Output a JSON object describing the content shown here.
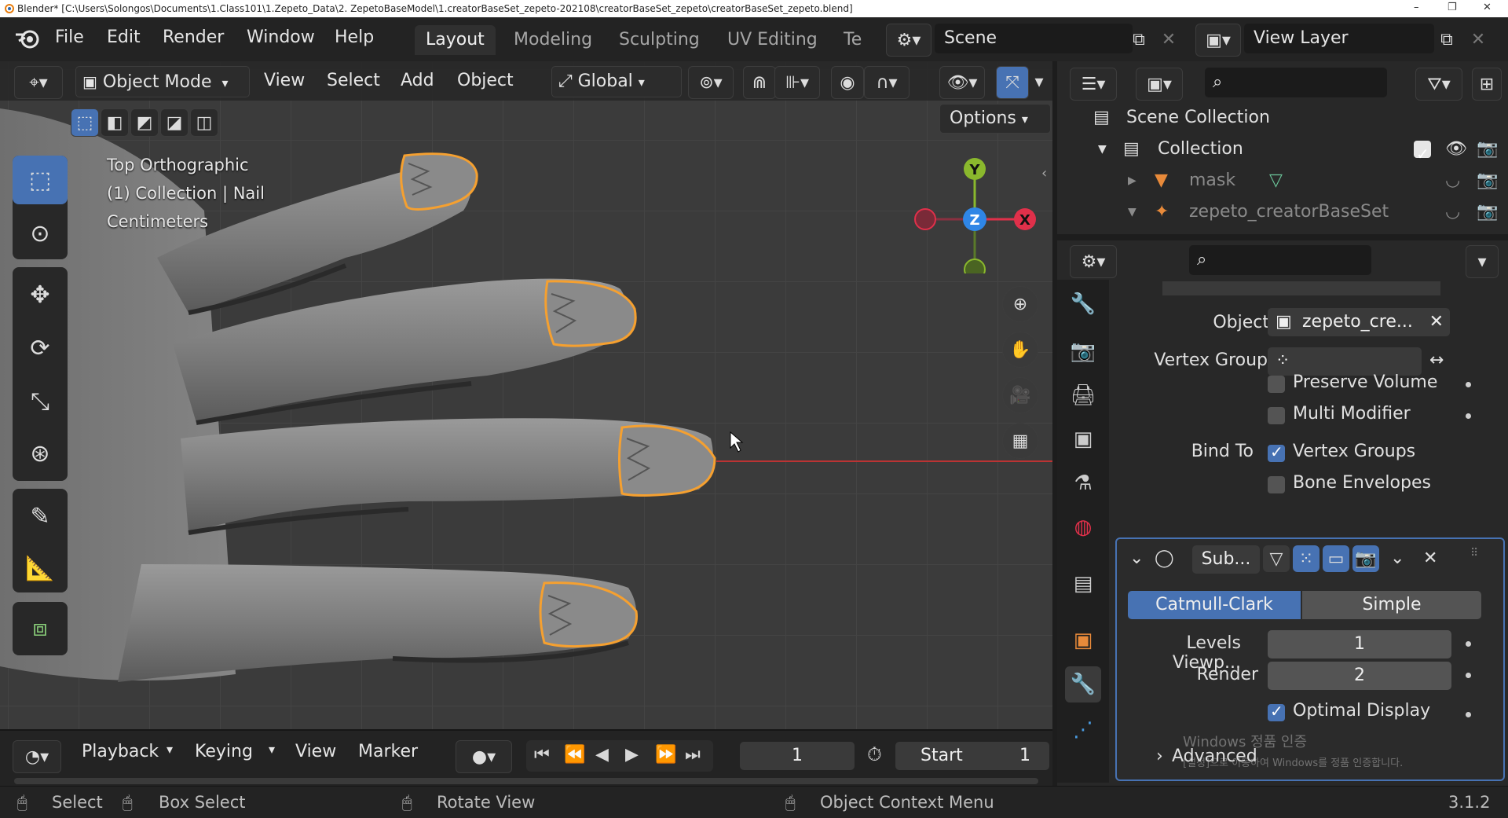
{
  "window": {
    "title": "Blender* [C:\\Users\\Solongos\\Documents\\1.Class101\\1.Zepeto_Data\\2. ZepetoBaseModel\\1.creatorBaseSet_zepeto-202108\\creatorBaseSet_zepeto\\creatorBaseSet_zepeto.blend]",
    "minimize": "–",
    "restore": "❐",
    "close": "✕"
  },
  "menu": {
    "items": [
      "File",
      "Edit",
      "Render",
      "Window",
      "Help"
    ],
    "workspaces": [
      "Layout",
      "Modeling",
      "Sculpting",
      "UV Editing",
      "Te"
    ],
    "active_workspace": "Layout",
    "scene": "Scene",
    "view_layer": "View Layer"
  },
  "viewport_header": {
    "mode": "Object Mode",
    "menus": [
      "View",
      "Select",
      "Add",
      "Object"
    ],
    "transform_orientation": "Global",
    "options": "Options"
  },
  "viewport_overlay": {
    "view_name": "Top Orthographic",
    "object_info": "(1) Collection | Nail",
    "units": "Centimeters"
  },
  "gizmo": {
    "y": "Y",
    "z": "Z",
    "x": "X"
  },
  "timeline": {
    "menus": [
      "Playback",
      "Keying",
      "View",
      "Marker"
    ],
    "current_frame": "1",
    "start_label": "Start",
    "start_value": "1"
  },
  "statusbar": {
    "select": "Select",
    "box_select": "Box Select",
    "rotate_view": "Rotate View",
    "context_menu": "Object Context Menu",
    "version": "3.1.2"
  },
  "outliner": {
    "scene_collection": "Scene Collection",
    "collection": "Collection",
    "items": [
      "mask",
      "zepeto_creatorBaseSet"
    ]
  },
  "properties": {
    "armature_modifier": {
      "object_label": "Object",
      "object_value": "zepeto_cre...",
      "vertex_group_label": "Vertex Group",
      "preserve_volume": "Preserve Volume",
      "multi_modifier": "Multi Modifier",
      "bind_to_label": "Bind To",
      "vertex_groups": "Vertex Groups",
      "bone_envelopes": "Bone Envelopes"
    },
    "subdivision_modifier": {
      "name": "Sub...",
      "catmull_clark": "Catmull-Clark",
      "simple": "Simple",
      "levels_viewport_label": "Levels Viewp...",
      "levels_viewport_value": "1",
      "render_label": "Render",
      "render_value": "2",
      "optimal_display": "Optimal Display",
      "advanced": "Advanced"
    },
    "activation_notice_1": "Windows 정품 인증",
    "activation_notice_2": "[설정]으로 이동하여 Windows를 정품 인증합니다."
  },
  "colors": {
    "accent": "#4772b3",
    "selection_outline": "#f5a030",
    "axis_x": "#e0304a",
    "axis_y": "#8ab82d",
    "axis_z": "#2f86e6"
  }
}
